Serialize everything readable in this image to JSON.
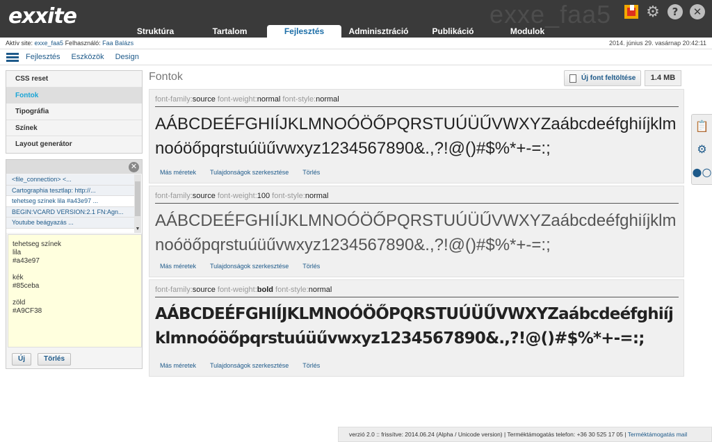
{
  "app": {
    "logo": "exxite",
    "site_watermark": "exxe_faa5"
  },
  "mainnav": [
    {
      "label": "Struktúra",
      "active": false
    },
    {
      "label": "Tartalom",
      "active": false
    },
    {
      "label": "Fejlesztés",
      "active": true
    },
    {
      "label": "Adminisztráció",
      "active": false
    },
    {
      "label": "Publikáció",
      "active": false
    },
    {
      "label": "Modulok",
      "active": false
    }
  ],
  "infobar": {
    "site_prefix": "Aktív site: ",
    "site": "exxe_faa5",
    "user_prefix": " Felhasználó: ",
    "user": "Faa Balázs",
    "date": "2014. június 29. vasárnap 20:42:11"
  },
  "subnav": [
    "Fejlesztés",
    "Eszközök",
    "Design"
  ],
  "sidemenu": [
    {
      "label": "CSS reset",
      "active": false
    },
    {
      "label": "Fontok",
      "active": true
    },
    {
      "label": "Tipográfia",
      "active": false
    },
    {
      "label": "Színek",
      "active": false
    },
    {
      "label": "Layout generátor",
      "active": false
    }
  ],
  "clipboard": {
    "items": [
      "<file_connection> <...",
      "Cartographia tesztlap: http://...",
      "tehetseg színek lila #a43e97 ...",
      "BEGIN:VCARD VERSION:2.1 FN:Agn...",
      "Youtube beágyazás ..."
    ],
    "selected_index": 2,
    "note": "tehetseg színek\nlila\n#a43e97\n\nkék\n#85ceba\n\nzöld\n#A9CF38",
    "new_label": "Új",
    "delete_label": "Törlés"
  },
  "content": {
    "title": "Fontok",
    "upload_label": "Új font feltöltése",
    "storage": "1.4 MB",
    "fonts": [
      {
        "family_label": "font-family:",
        "family": "source",
        "weight_label": " font-weight:",
        "weight": "normal",
        "style_label": " font-style:",
        "style": "normal",
        "sample": "AÁBCDEÉFGHIÍJKLMNOÓÖŐPQRSTUÚÜŰVWXYZaábcdeéfghiíjklmnoóöőpqrstuúüűvwxyz1234567890&.,?!@()#$%*+-=:;"
      },
      {
        "family_label": "font-family:",
        "family": "source",
        "weight_label": " font-weight:",
        "weight": "100",
        "style_label": " font-style:",
        "style": "normal",
        "sample": "AÁBCDEÉFGHIÍJKLMNOÓÖŐPQRSTUÚÜŰVWXYZaábcdeéfghiíjklmnoóöőpqrstuúüűvwxyz1234567890&.,?!@()#$%*+-=:;"
      },
      {
        "family_label": "font-family:",
        "family": "source",
        "weight_label": " font-weight:",
        "weight": "bold",
        "style_label": " font-style:",
        "style": "normal",
        "sample": "AÁBCDEÉFGHIÍJKLMNOÓÖŐPQRSTUÚÜŰVWXYZaábcdeéfghiíjklmnoóöőpqrstuúüűvwxyz1234567890&.,?!@()#$%*+-=:;"
      }
    ],
    "actions": [
      "Más méretek",
      "Tulajdonságok szerkesztése",
      "Törlés"
    ]
  },
  "rightbar_icons": [
    "clipboard-icon",
    "settings-icon",
    "toggle-icon"
  ],
  "footer": {
    "text": "verzió 2.0 :: frissítve: 2014.06.24 (Alpha / Unicode version) | Terméktámogatás telefon: +36 30 525 17 05 | ",
    "link": "Terméktámogatás mail"
  }
}
